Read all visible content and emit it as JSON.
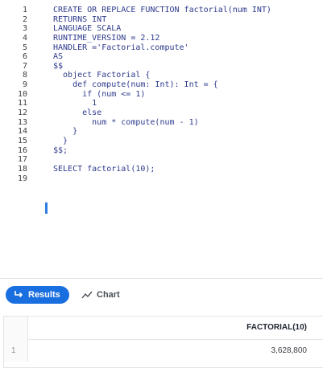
{
  "editor": {
    "line_numbers": [
      "1",
      "2",
      "3",
      "4",
      "5",
      "6",
      "7",
      "8",
      "9",
      "10",
      "11",
      "12",
      "13",
      "14",
      "15",
      "16",
      "17",
      "18",
      "19"
    ],
    "lines": [
      "CREATE OR REPLACE FUNCTION factorial(num INT)",
      "RETURNS INT",
      "LANGUAGE SCALA",
      "RUNTIME_VERSION = 2.12",
      "HANDLER ='Factorial.compute'",
      "AS",
      "$$",
      "  object Factorial {",
      "    def compute(num: Int): Int = {",
      "      if (num <= 1)",
      "        1",
      "      else",
      "        num * compute(num - 1)",
      "    }",
      "  }",
      "$$;",
      "",
      "SELECT factorial(10);",
      ""
    ]
  },
  "toolbar": {
    "results_label": "Results",
    "chart_label": "Chart",
    "results_icon": "return-arrow-icon",
    "chart_icon": "line-chart-icon",
    "accent": "#1a6fe0"
  },
  "results": {
    "columns": [
      "FACTORIAL(10)"
    ],
    "rows": [
      {
        "num": "1",
        "values": [
          "3,628,800"
        ]
      }
    ]
  }
}
